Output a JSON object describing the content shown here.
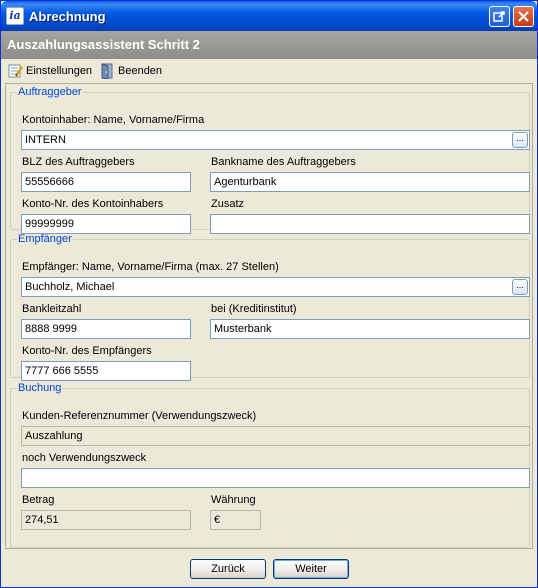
{
  "window": {
    "title": "Abrechnung",
    "icon_text": "ia"
  },
  "header": {
    "title": "Auszahlungsassistent Schritt 2"
  },
  "toolbar": {
    "settings_label": "Einstellungen",
    "exit_label": "Beenden"
  },
  "auftraggeber": {
    "legend": "Auftraggeber",
    "holder_label": "Kontoinhaber: Name, Vorname/Firma",
    "holder_value": "INTERN",
    "blz_label": "BLZ des Auftraggebers",
    "blz_value": "55556666",
    "bank_label": "Bankname des Auftraggebers",
    "bank_value": "Agenturbank",
    "account_label": "Konto-Nr. des Kontoinhabers",
    "account_value": "99999999",
    "extra_label": "Zusatz",
    "extra_value": ""
  },
  "empfaenger": {
    "legend": "Empfänger",
    "name_label": "Empfänger: Name, Vorname/Firma (max. 27 Stellen)",
    "name_value": "Buchholz, Michael",
    "blz_label": "Bankleitzahl",
    "blz_value": "8888 9999",
    "bank_label": "bei (Kreditinstitut)",
    "bank_value": "Musterbank",
    "account_label": "Konto-Nr. des Empfängers",
    "account_value": "7777 666 5555"
  },
  "buchung": {
    "legend": "Buchung",
    "ref_label": "Kunden-Referenznummer (Verwendungszweck)",
    "ref_value": "Auszahlung",
    "purpose_label": "noch Verwendungszweck",
    "purpose_value": "",
    "amount_label": "Betrag",
    "amount_value": "274,51",
    "currency_label": "Währung",
    "currency_value": "€"
  },
  "buttons": {
    "back": "Zurück",
    "next": "Weiter",
    "browse": "..."
  }
}
